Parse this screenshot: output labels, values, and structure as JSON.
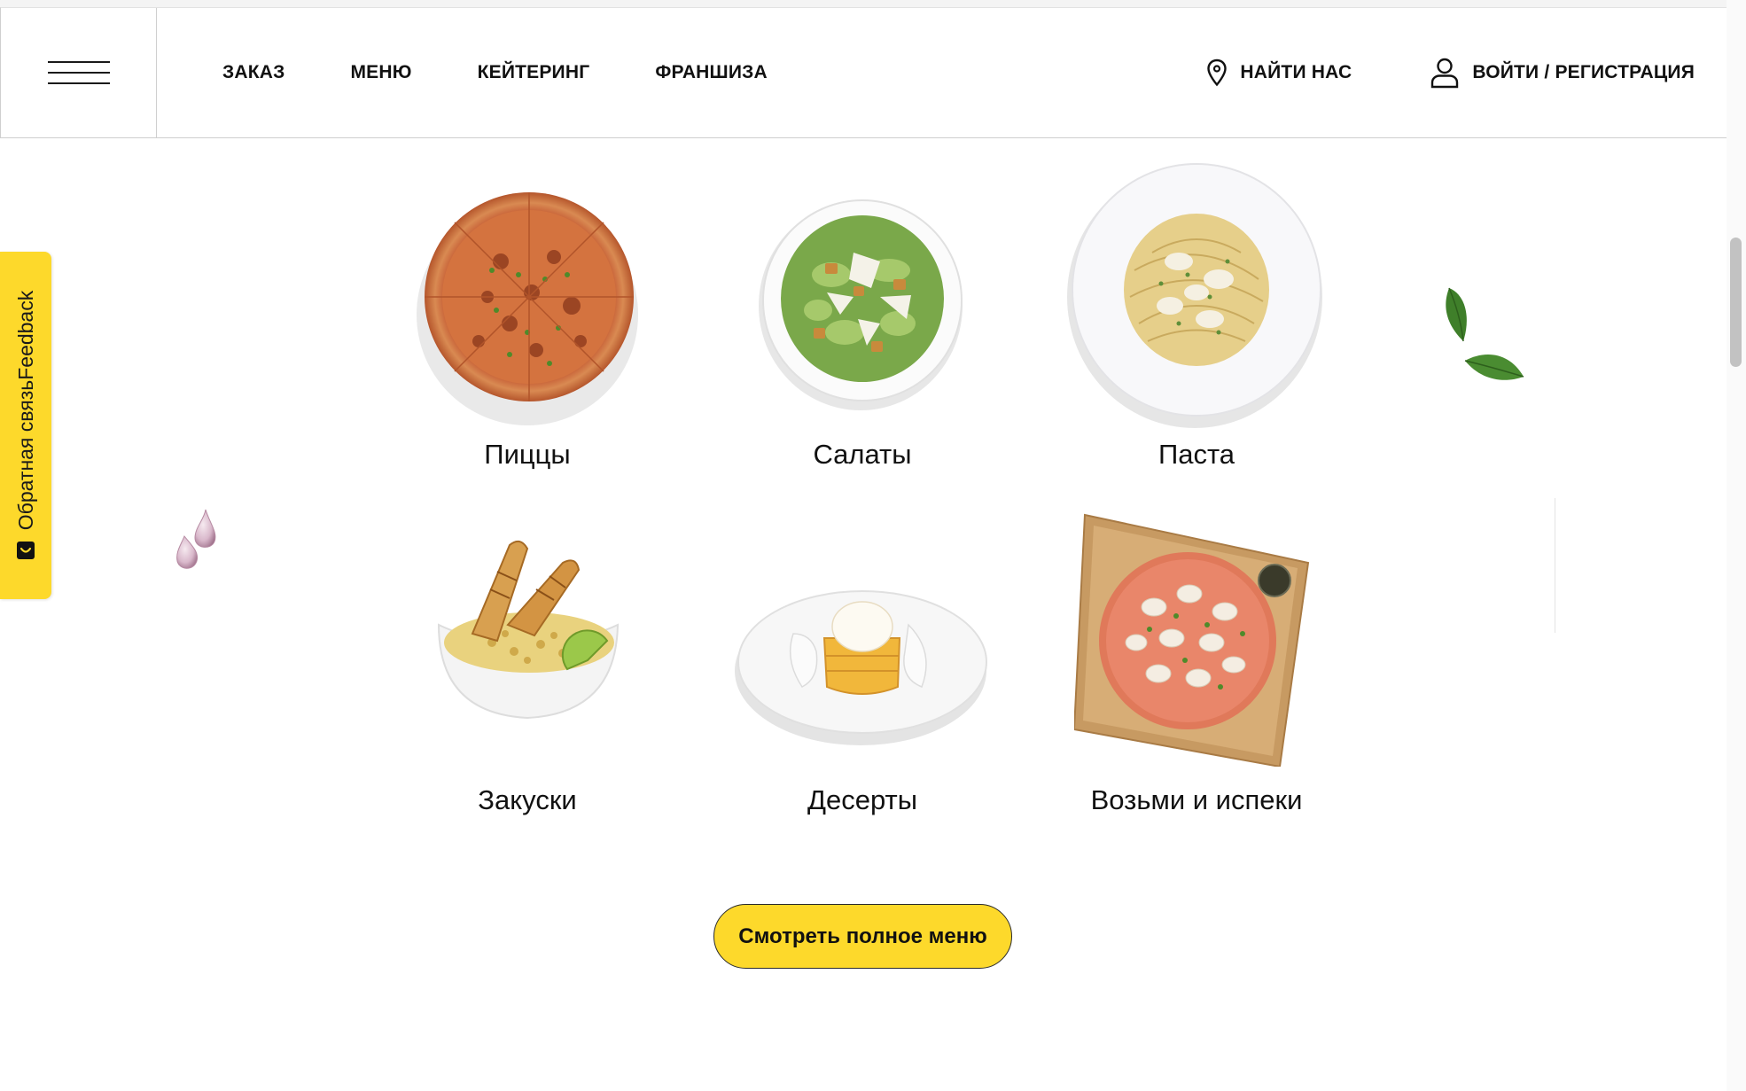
{
  "header": {
    "nav": [
      "ЗАКАЗ",
      "МЕНЮ",
      "КЕЙТЕРИНГ",
      "ФРАНШИЗА"
    ],
    "find_us": "НАЙТИ НАС",
    "login": "ВОЙТИ / РЕГИСТРАЦИЯ",
    "icons": {
      "menu": "hamburger-icon",
      "location": "location-pin-icon",
      "account": "user-icon"
    }
  },
  "feedback": {
    "label": "Обратная связьFeedback",
    "icon": "chat-bubble-icon",
    "color": "#fdd92b"
  },
  "categories": [
    {
      "label": "Пиццы",
      "image": "pizza-image"
    },
    {
      "label": "Салаты",
      "image": "salad-image"
    },
    {
      "label": "Паста",
      "image": "pasta-image"
    },
    {
      "label": "Закуски",
      "image": "appetizer-image"
    },
    {
      "label": "Десерты",
      "image": "dessert-image"
    },
    {
      "label": "Возьми и испеки",
      "image": "take-and-bake-image"
    }
  ],
  "cta": {
    "label": "Смотреть полное меню",
    "color": "#fdd92b"
  },
  "colors": {
    "accent": "#fdd92b",
    "text": "#111111",
    "border": "#cfcfcf"
  }
}
